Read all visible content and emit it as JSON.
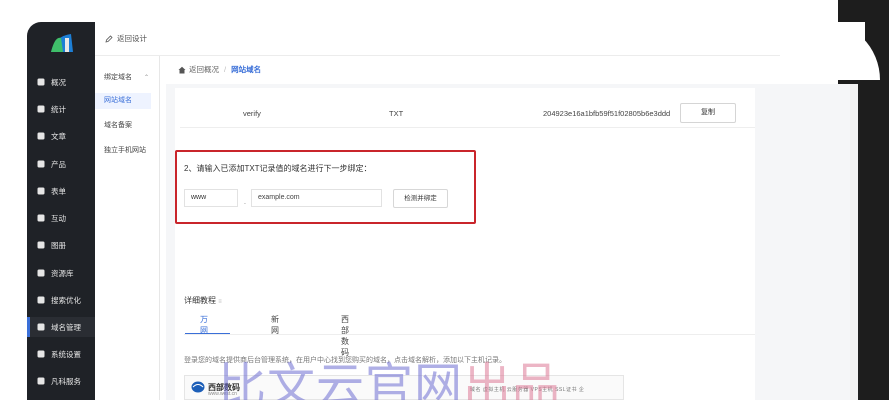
{
  "sidebar": {
    "items": [
      {
        "label": "概况",
        "icon": "home-icon"
      },
      {
        "label": "统计",
        "icon": "stats-icon"
      },
      {
        "label": "文章",
        "icon": "article-icon"
      },
      {
        "label": "产品",
        "icon": "product-icon"
      },
      {
        "label": "表单",
        "icon": "form-icon"
      },
      {
        "label": "互动",
        "icon": "chat-icon"
      },
      {
        "label": "图册",
        "icon": "album-icon"
      },
      {
        "label": "资源库",
        "icon": "library-icon"
      },
      {
        "label": "搜索优化",
        "icon": "seo-icon"
      },
      {
        "label": "域名管理",
        "icon": "domain-icon"
      },
      {
        "label": "系统设置",
        "icon": "gear-icon"
      },
      {
        "label": "凡科服务",
        "icon": "diamond-icon"
      }
    ],
    "active_index": 9
  },
  "topbar": {
    "back_design": "返回设计"
  },
  "submenu": {
    "items": [
      {
        "label": "绑定域名"
      },
      {
        "label": "网站域名"
      },
      {
        "label": "域名备案"
      },
      {
        "label": "独立手机网站"
      }
    ]
  },
  "breadcrumb": {
    "home": "返回概况",
    "current": "网站域名"
  },
  "dns": {
    "host": "verify",
    "type": "TXT",
    "value": "204923e16a1bfb59f51f02805b6e3ddd",
    "copy_label": "复制"
  },
  "bind": {
    "title": "2、请输入已添加TXT记录值的域名进行下一步绑定：",
    "prefix_value": "www",
    "dot": ".",
    "domain_placeholder": "example.com",
    "check_label": "检测并绑定"
  },
  "tutorial": {
    "title": "详细教程",
    "tabs": [
      "万网",
      "新网",
      "西部数码"
    ],
    "active_tab": 0,
    "text": "登录您的域名提供商后台管理系统，在用户中心找到您购买的域名，点击域名解析，添加以下主机记录。",
    "brand": "西部数码",
    "brand_sub": "www.west.cn",
    "menu": "域名  虚拟主机  云服务器  VPS主机  SSL证书  企"
  },
  "watermark": {
    "main": "比文云官网",
    "tail": "出品"
  }
}
